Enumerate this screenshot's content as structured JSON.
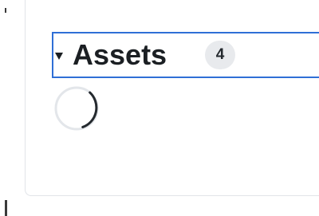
{
  "assets_section": {
    "title": "Assets",
    "count": "4",
    "expanded": true
  },
  "icons": {
    "toggle": "disclosure-triangle-down-icon",
    "loading": "loading-spinner-icon"
  },
  "colors": {
    "focus_outline": "#2f6fd6",
    "counter_bg": "#e8eaed",
    "text": "#1b1f23",
    "panel_border": "#e1e4e8"
  }
}
